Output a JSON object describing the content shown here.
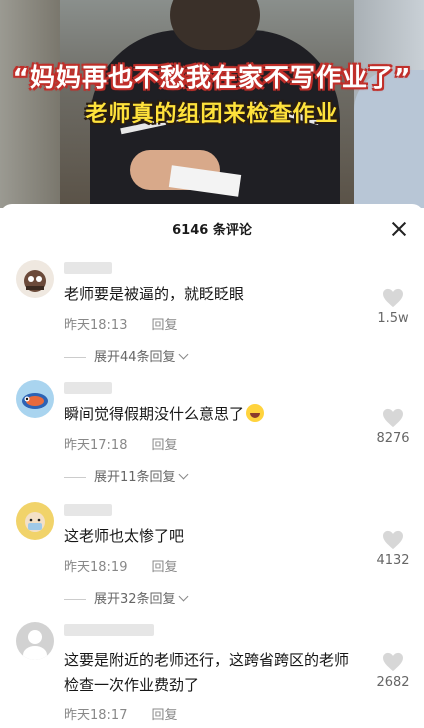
{
  "video": {
    "caption_line1": "“妈妈再也不愁我在家不写作业了”",
    "caption_line2": "老师真的组团来检查作业"
  },
  "comments_panel": {
    "title": "6146 条评论",
    "close_icon": "close-icon"
  },
  "comments": [
    {
      "text": "老师要是被逼的，就眨眨眼",
      "time": "昨天18:13",
      "reply_label": "回复",
      "expand_label": "展开44条回复",
      "likes": "1.5w",
      "avatar_color": "#6b4a3a"
    },
    {
      "text": "瞬间觉得假期没什么意思了",
      "time": "昨天17:18",
      "reply_label": "回复",
      "expand_label": "展开11条回复",
      "likes": "8276",
      "avatar_color": "#4b82c8"
    },
    {
      "text": "这老师也太惨了吧",
      "time": "昨天18:19",
      "reply_label": "回复",
      "expand_label": "展开32条回复",
      "likes": "4132",
      "avatar_color": "#e0c23a"
    },
    {
      "text_line1": "这要是附近的老师还行，这跨省跨区的老师",
      "text_line2": "检查一次作业费劲了",
      "time": "昨天18:17",
      "reply_label": "回复",
      "likes": "2682",
      "avatar_color": "#c8c8c8"
    }
  ]
}
